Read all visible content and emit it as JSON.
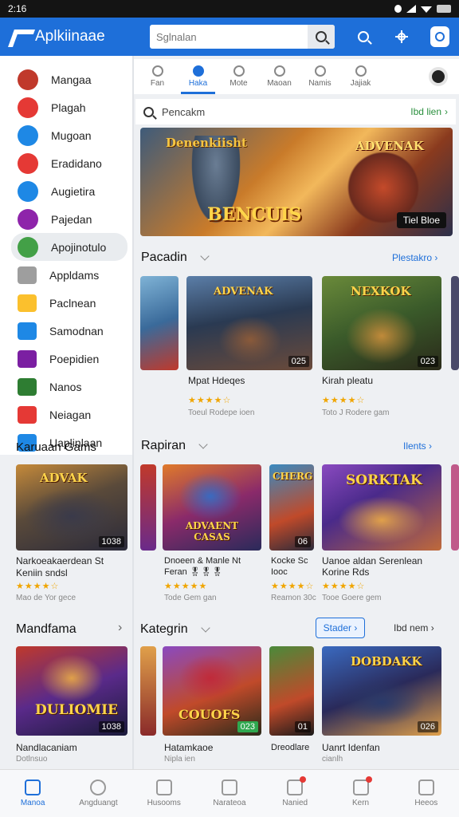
{
  "status": {
    "time": "2:16"
  },
  "app": {
    "title": "Aplkiinaae",
    "search_placeholder": "Sglnalan"
  },
  "sidebar": {
    "items": [
      {
        "label": "Mangaa",
        "color": "#c0392b"
      },
      {
        "label": "Plagah",
        "color": "#e53935"
      },
      {
        "label": "Mugoan",
        "color": "#1e88e5"
      },
      {
        "label": "Eradidano",
        "color": "#e53935"
      },
      {
        "label": "Augietira",
        "color": "#1e88e5"
      },
      {
        "label": "Pajedan",
        "color": "#8e24aa"
      },
      {
        "label": "Apojinotulo",
        "color": "#43a047"
      },
      {
        "label": "Appldams",
        "color": "#9e9e9e"
      },
      {
        "label": "Paclnean",
        "color": "#fbc02d"
      },
      {
        "label": "Samodnan",
        "color": "#1e88e5"
      },
      {
        "label": "Poepidien",
        "color": "#7b1fa2"
      },
      {
        "label": "Nanos",
        "color": "#2e7d32"
      },
      {
        "label": "Neiagan",
        "color": "#e53935"
      },
      {
        "label": "Uaplinlaan",
        "color": "#1e88e5"
      }
    ],
    "section_title": "Karuaan Gams"
  },
  "tabs": [
    {
      "label": "Fan"
    },
    {
      "label": "Haka"
    },
    {
      "label": "Mote"
    },
    {
      "label": "Maoan"
    },
    {
      "label": "Namis"
    },
    {
      "label": "Jajiak"
    }
  ],
  "searchrow": {
    "label": "Pencakm",
    "link": "Ibd lien"
  },
  "banner": {
    "title_left": "Denenkiisht",
    "title_right": "ADVENAK",
    "headline": "BENCUIS",
    "badge": "Tiel Bloe"
  },
  "sections": {
    "s1": {
      "title": "Pacadin",
      "link": "Plestakro"
    },
    "s2": {
      "title": "Rapiran",
      "link": "Ilents"
    },
    "s3": {
      "title": "Kategrin",
      "link": "Ibd nem",
      "button": "Stader"
    },
    "left3": {
      "title": "Mandfama"
    }
  },
  "cards": {
    "c1": {
      "caption": "Mpat Hdeqes",
      "rating": "★★★★☆",
      "sub": "Toeul Rodepe ioen",
      "badge": "025",
      "art": "ADVENAK"
    },
    "c2": {
      "caption": "Kirah pleatu",
      "rating": "★★★★☆",
      "sub": "Toto J Rodere gam",
      "badge": "023",
      "art": "NEXKOK"
    },
    "left1": {
      "caption1": "Narkoeakaerdean St",
      "caption2": "Keniin sndsl",
      "rating": "★★★★☆",
      "sub": "Mao de Yor gece",
      "badge": "1038",
      "art": "ADVAK"
    },
    "c3": {
      "caption1": "Dnoeen & Manle Nt",
      "caption2": "Feran 🎖🎖🎖",
      "rating": "★★★★★",
      "sub": "Tode Gem gan",
      "badge": "",
      "art": "ADVAENT CASAS"
    },
    "c4": {
      "caption1": "Kocke Sc",
      "caption2": "Iooc",
      "rating": "★★★★☆",
      "sub": "Reamon 30c",
      "badge": "06",
      "art": "CHERG"
    },
    "c5": {
      "caption1": "Uanoe aldan Serenlean",
      "caption2": "Korine Rds",
      "rating": "★★★★☆",
      "sub": "Tooe Goere gem",
      "badge": "",
      "art": "SORKTAK"
    },
    "left2": {
      "caption1": "Nandlacaniam",
      "caption2": "Dotlnsuo",
      "badge": "1038",
      "art": "DULIOMIE"
    },
    "c6": {
      "caption1": "Hatamkaoe",
      "caption2": "Nipla ien",
      "badge": "023",
      "art": "COUOFS"
    },
    "c7": {
      "caption1": "Dreodlare",
      "badge": "01",
      "art": ""
    },
    "c8": {
      "caption1": "Uanrt Idenfan",
      "caption2": "cianlh",
      "badge": "026",
      "art": "DOBDAKK"
    }
  },
  "bottom_nav": [
    {
      "label": "Manoa"
    },
    {
      "label": "Angduangt"
    },
    {
      "label": "Husooms"
    },
    {
      "label": "Narateoa"
    },
    {
      "label": "Nanied"
    },
    {
      "label": "Kern"
    },
    {
      "label": "Heeos"
    }
  ]
}
